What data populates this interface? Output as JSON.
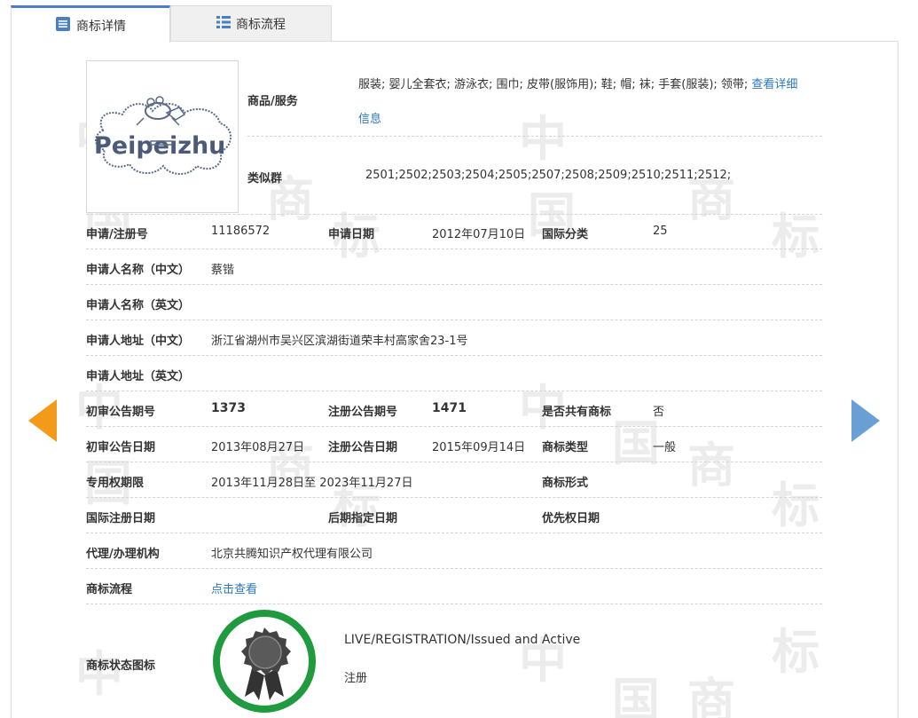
{
  "tabs": [
    {
      "label": "商标详情",
      "icon": "document-list-icon"
    },
    {
      "label": "商标流程",
      "icon": "list-icon"
    }
  ],
  "logo": {
    "text": "Peipeizhu"
  },
  "goods": {
    "label": "商品/服务",
    "value": "服装; 婴儿全套衣; 游泳衣; 围巾; 皮带(服饰用); 鞋; 帽; 袜; 手套(服装); 领带;",
    "link_line1": "查看详细",
    "link_line2": "信息"
  },
  "similar_group": {
    "label": "类似群",
    "value": "2501;2502;2503;2504;2505;2507;2508;2509;2510;2511;2512;"
  },
  "rows": {
    "reg_no": {
      "label": "申请/注册号",
      "value": "11186572"
    },
    "apply_date": {
      "label": "申请日期",
      "value": "2012年07月10日"
    },
    "intl_class": {
      "label": "国际分类",
      "value": "25"
    },
    "applicant_cn": {
      "label": "申请人名称（中文）",
      "value": "蔡锴"
    },
    "applicant_en": {
      "label": "申请人名称（英文）",
      "value": ""
    },
    "address_cn": {
      "label": "申请人地址（中文）",
      "value": "浙江省湖州市吴兴区滨湖街道荣丰村高家舍23-1号"
    },
    "address_en": {
      "label": "申请人地址（英文）",
      "value": ""
    },
    "prelim_issue": {
      "label": "初审公告期号",
      "value": "1373"
    },
    "reg_issue": {
      "label": "注册公告期号",
      "value": "1471"
    },
    "shared": {
      "label": "是否共有商标",
      "value": "否"
    },
    "prelim_date": {
      "label": "初审公告日期",
      "value": "2013年08月27日"
    },
    "reg_date": {
      "label": "注册公告日期",
      "value": "2015年09月14日"
    },
    "tm_type": {
      "label": "商标类型",
      "value": "一般"
    },
    "exclusive_period": {
      "label": "专用权期限",
      "value": "2013年11月28日至 2023年11月27日"
    },
    "tm_form": {
      "label": "商标形式",
      "value": ""
    },
    "intl_reg_date": {
      "label": "国际注册日期",
      "value": ""
    },
    "later_designation": {
      "label": "后期指定日期",
      "value": ""
    },
    "priority_date": {
      "label": "优先权日期",
      "value": ""
    },
    "agent": {
      "label": "代理/办理机构",
      "value": "北京共腾知识产权代理有限公司"
    },
    "process": {
      "label": "商标流程",
      "value": "点击查看"
    }
  },
  "status": {
    "label": "商标状态图标",
    "line1": "LIVE/REGISTRATION/Issued and Active",
    "line2": "注册"
  },
  "watermark": {
    "char1": "中",
    "char2": "国",
    "char3": "商",
    "char4": "标"
  },
  "colors": {
    "accent": "#2a78c2",
    "tab_border": "#4a7fc7",
    "arrow_left": "#f39a1b",
    "arrow_right": "#6a9fd6",
    "badge_ring": "#1f9a3f"
  }
}
